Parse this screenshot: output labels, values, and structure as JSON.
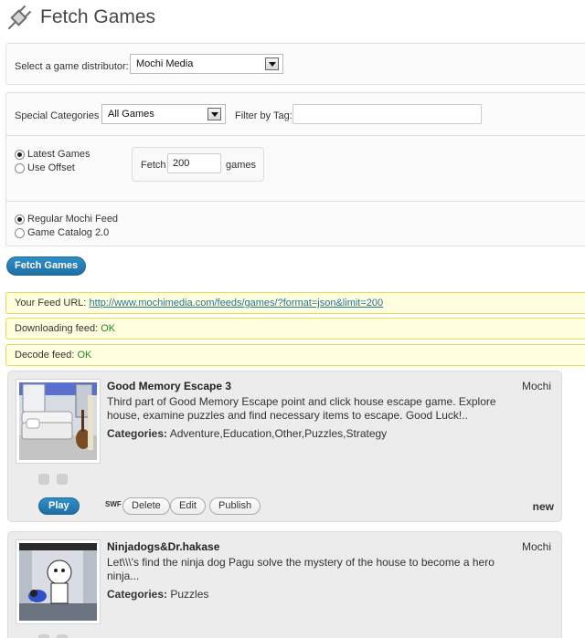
{
  "page": {
    "title": "Fetch Games",
    "icon": "plug-icon"
  },
  "distributor": {
    "label": "Select a game distributor:",
    "selected": "Mochi Media"
  },
  "filters": {
    "special_categories_label": "Special Categories",
    "special_categories_selected": "All Games",
    "filter_tag_label": "Filter by Tag:",
    "filter_tag_value": ""
  },
  "fetch_mode": {
    "latest_label": "Latest Games",
    "offset_label": "Use Offset",
    "selected": "latest",
    "fetch_label": "Fetch",
    "fetch_value": "200",
    "games_label": "games"
  },
  "feed_type": {
    "regular_label": "Regular Mochi Feed",
    "catalog_label": "Game Catalog 2.0",
    "selected": "regular"
  },
  "fetch_button": "Fetch Games",
  "notices": {
    "feed_url_label": "Your Feed URL:",
    "feed_url": "http://www.mochimedia.com/feeds/games/?format=json&limit=200",
    "downloading_label": "Downloading feed:",
    "downloading_status": "OK",
    "decode_label": "Decode feed:",
    "decode_status": "OK"
  },
  "games": [
    {
      "title": "Good Memory Escape 3",
      "source": "Mochi",
      "description": "Third part of Good Memory Escape point and click house escape game. Explore house, examine puzzles and find necessary items to escape. Good Luck!..",
      "categories_label": "Categories:",
      "categories": "Adventure,Education,Other,Puzzles,Strategy",
      "play_label": "Play",
      "delete_label": "Delete",
      "edit_label": "Edit",
      "publish_label": "Publish",
      "status": "new",
      "swf_label": "SWF"
    },
    {
      "title": "Ninjadogs&Dr.hakase",
      "source": "Mochi",
      "description": "Let\\\\\\'s find the ninja dog Pagu solve the mystery of the house to become a hero ninja...",
      "categories_label": "Categories:",
      "categories": "Puzzles"
    }
  ],
  "colors": {
    "primary_button": "#21759b",
    "notice_bg": "#ffffe0",
    "notice_border": "#e6db55",
    "ok_green": "#1b8a1b",
    "link": "#21759b"
  }
}
